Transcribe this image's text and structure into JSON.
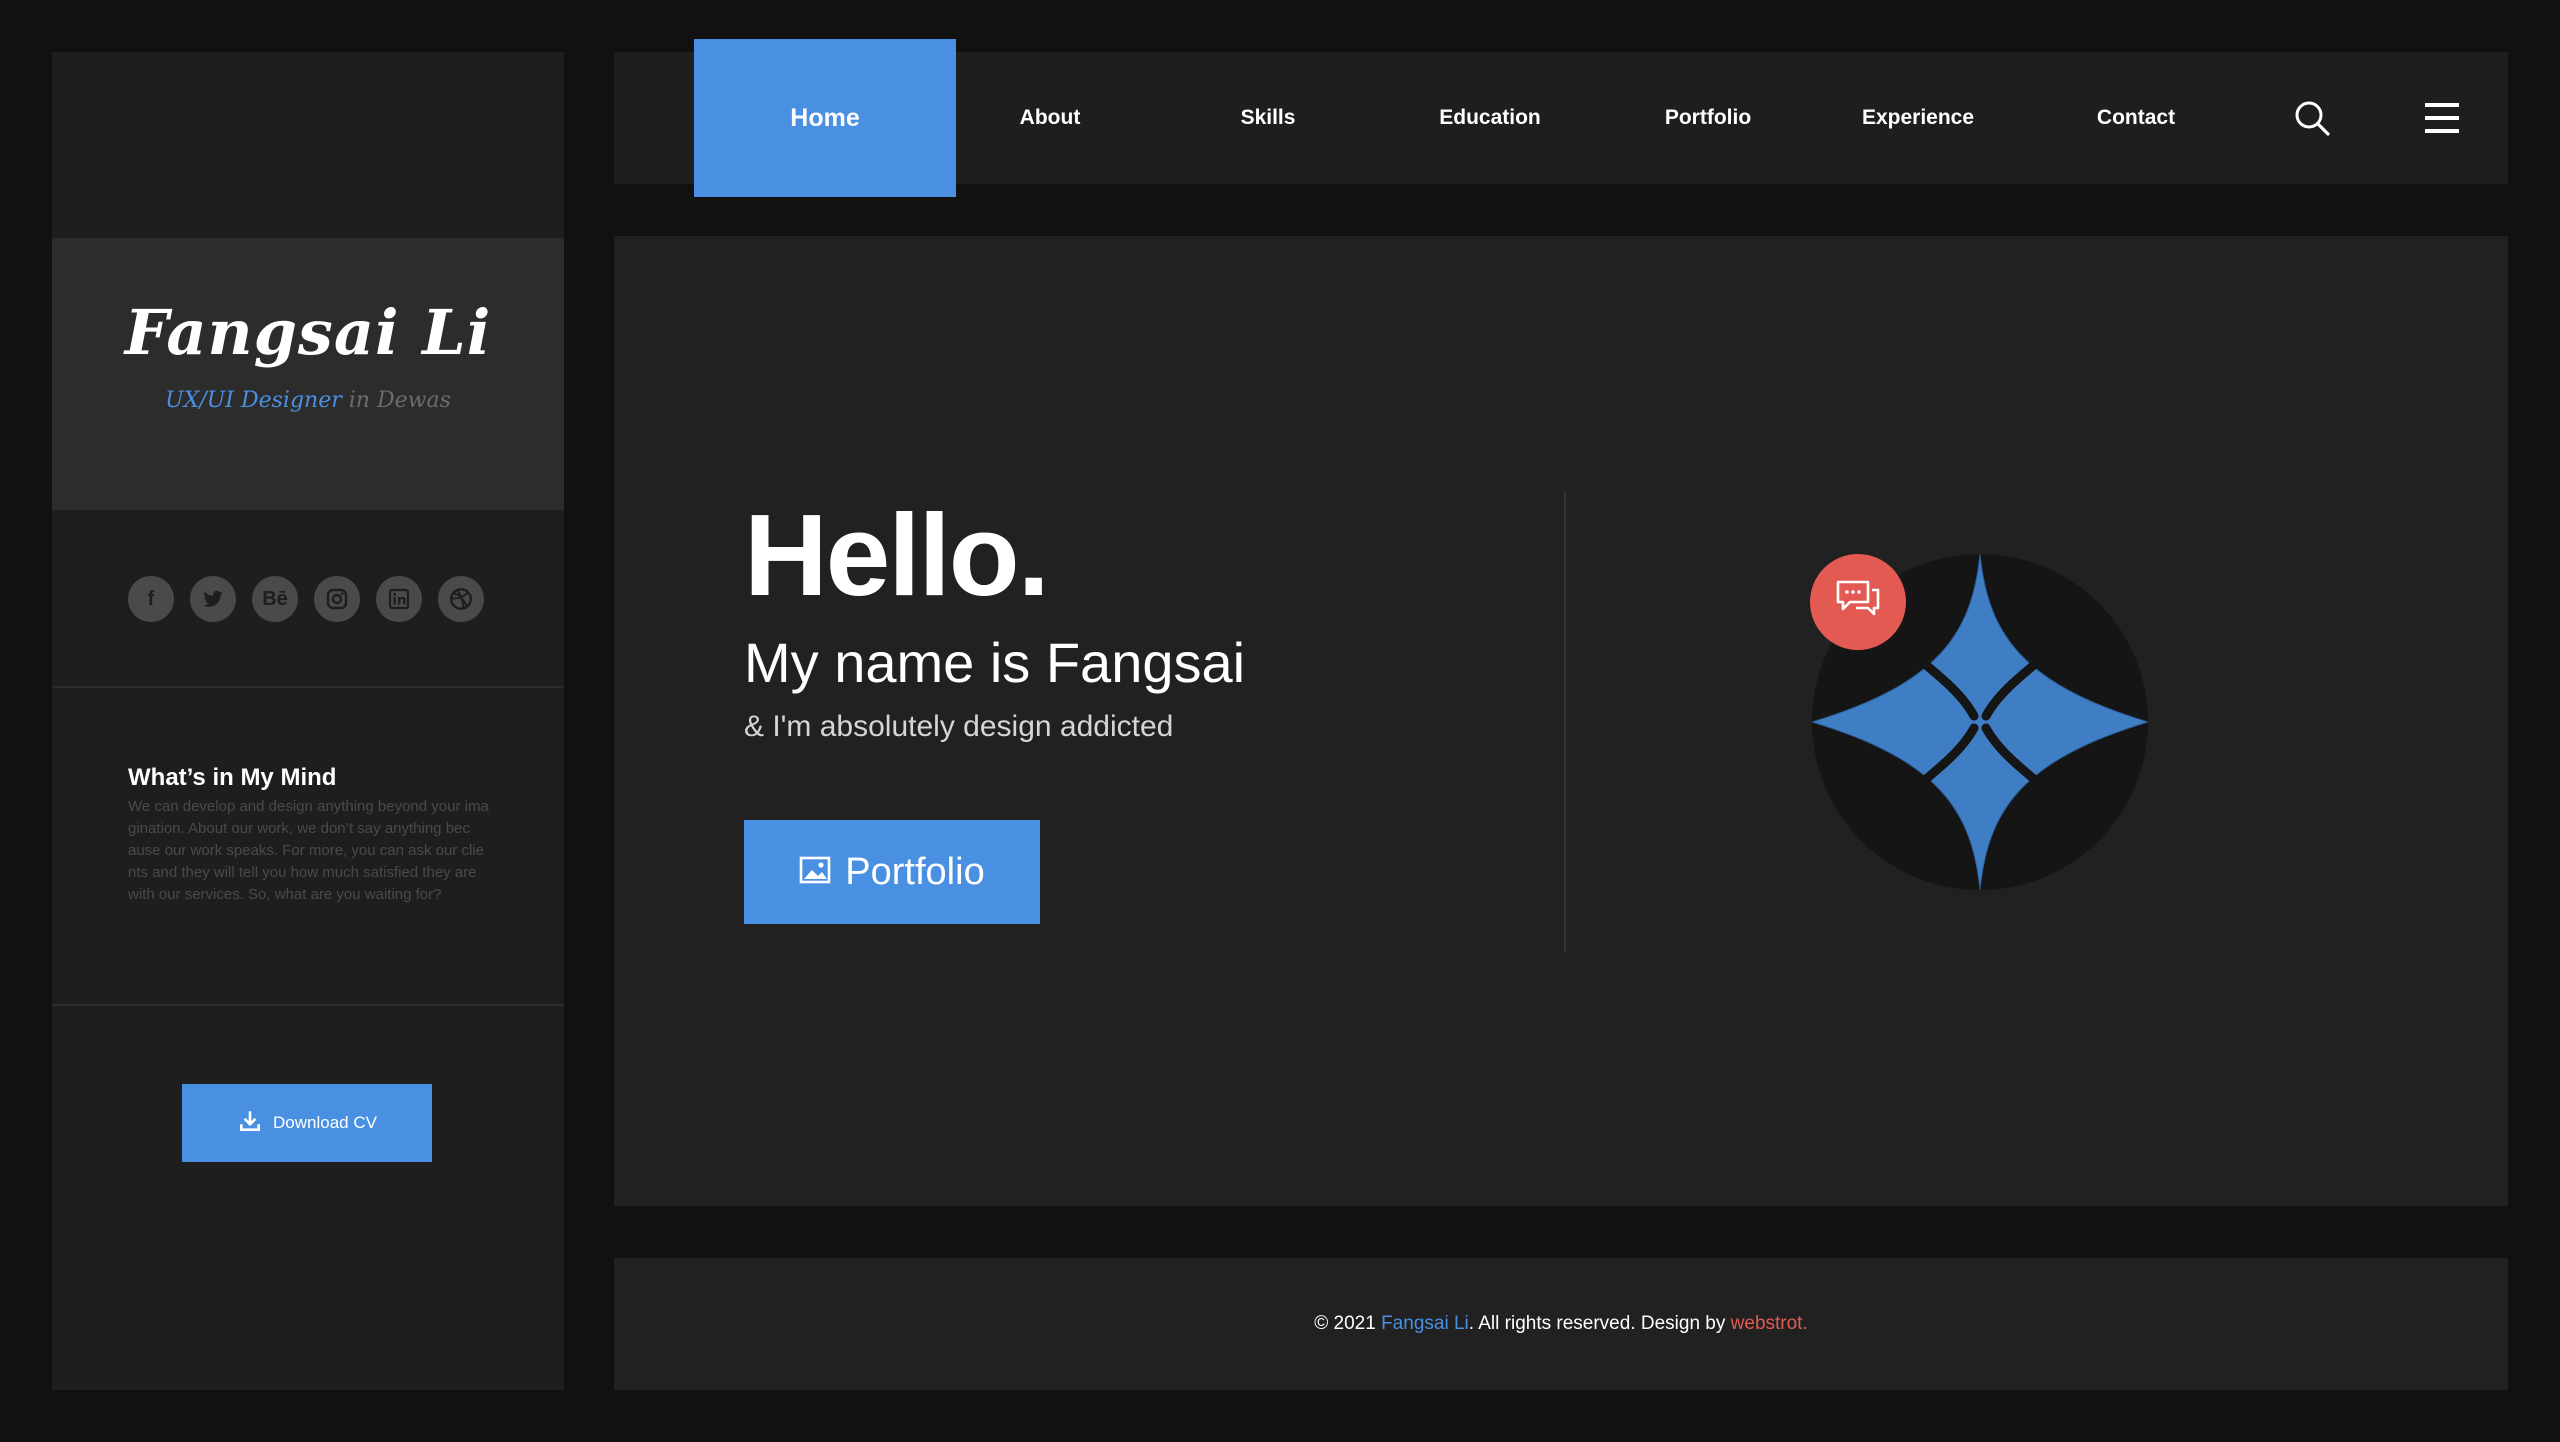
{
  "sidebar": {
    "name": "Fangsai Li",
    "role": "UX/UI Designer",
    "location": " in Dewas",
    "social": [
      {
        "icon": "facebook-icon",
        "glyph": "f"
      },
      {
        "icon": "twitter-icon",
        "glyph": "t"
      },
      {
        "icon": "behance-icon",
        "glyph": "Bē"
      },
      {
        "icon": "instagram-icon",
        "glyph": "◎"
      },
      {
        "icon": "linkedin-icon",
        "glyph": "in"
      },
      {
        "icon": "dribbble-icon",
        "glyph": "◍"
      }
    ],
    "mind_title": "What’s in My Mind",
    "mind_text": "We can develop and design anything beyond your ima gination. About our work, we don’t say anything bec ause our work speaks. For more, you can ask our clie nts and they will tell you how much satisfied they are with our services. So, what are you waiting for?",
    "download_label": "Download CV"
  },
  "nav": {
    "items": [
      "Home",
      "About",
      "Skills",
      "Education",
      "Portfolio",
      "Experience",
      "Contact"
    ],
    "active": "Home"
  },
  "hero": {
    "hello": "Hello.",
    "name_line": "My name is Fangsai",
    "tagline": "& I'm absolutely design addicted",
    "portfolio_label": "Portfolio"
  },
  "footer": {
    "prefix": "© 2021 ",
    "name": "Fangsai Li",
    "middle": ". All rights reserved. Design by ",
    "credit": "webstrot."
  },
  "colors": {
    "accent": "#4a90e2",
    "badge": "#e25a52",
    "background": "#111112",
    "panel": "#1e1e1f"
  }
}
